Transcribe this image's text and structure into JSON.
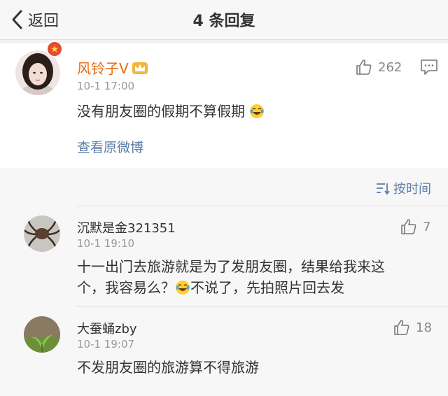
{
  "header": {
    "back_label": "返回",
    "title": "4 条回复"
  },
  "main_post": {
    "username": "风铃子V",
    "time": "10-1 17:00",
    "content": "没有朋友圈的假期不算假期",
    "like_count": "262",
    "view_original_label": "查看原微博"
  },
  "sort": {
    "label": "按时间"
  },
  "replies": [
    {
      "username": "沉默是金321351",
      "time": "10-1 19:10",
      "content_line1": "十一出门去旅游就是为了发朋友圈，结果给我来这",
      "content_line2_a": "个，我容易么？",
      "content_line2_b": "不说了，先拍照片回去发",
      "like_count": "7"
    },
    {
      "username": "大蚕蛹zby",
      "time": "10-1 19:07",
      "content": "不发朋友圈的旅游算不得旅游",
      "like_count": "18"
    }
  ],
  "colors": {
    "brand_orange": "#e86a0f",
    "link_blue": "#5b7ea6",
    "badge_red": "#e8492f"
  }
}
